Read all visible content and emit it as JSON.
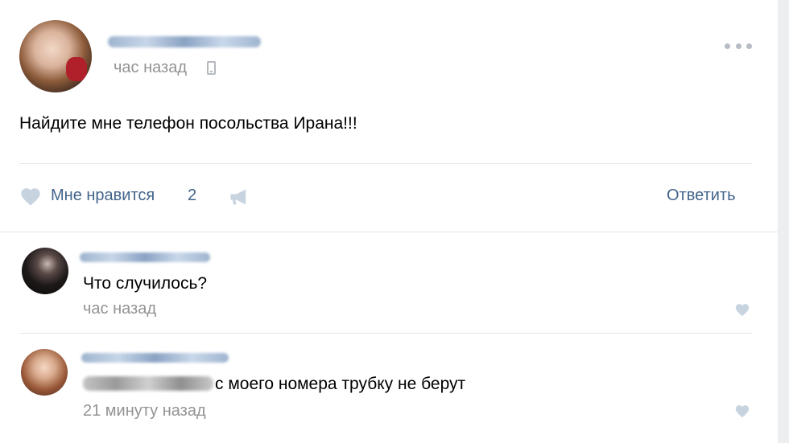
{
  "post": {
    "time": "час назад",
    "text": "Найдите мне телефон посольства Ирана!!!",
    "like_label": "Мне нравится",
    "like_count": "2",
    "reply_label": "Ответить"
  },
  "comments": [
    {
      "text": "Что случилось?",
      "time": "час назад"
    },
    {
      "text": "с моего номера трубку не берут",
      "time": "21 минуту назад"
    }
  ],
  "icons": {
    "like": "heart-icon",
    "share": "megaphone-icon",
    "more": "more-dots-icon",
    "device": "phone-icon"
  },
  "colors": {
    "link": "#42648b",
    "muted": "#939393",
    "icon": "#b7bcc4"
  }
}
